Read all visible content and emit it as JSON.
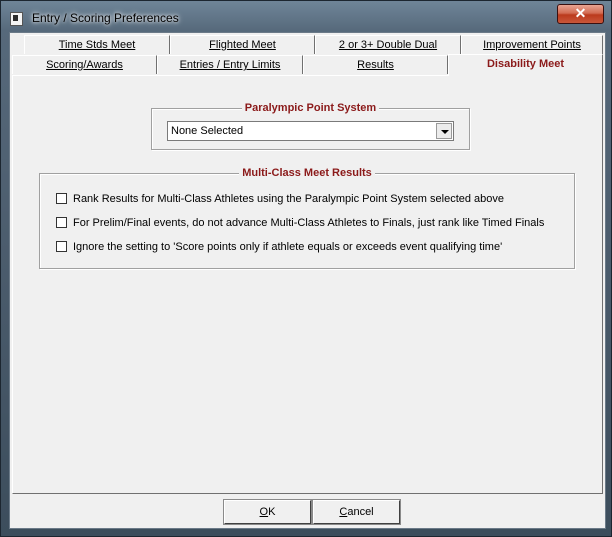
{
  "window": {
    "title": "Entry / Scoring Preferences",
    "close_label": "✕"
  },
  "tabs": {
    "row_top": [
      {
        "label": "Time Stds Meet"
      },
      {
        "label": "Flighted Meet"
      },
      {
        "label": "2 or 3+ Double Dual"
      },
      {
        "label": "Improvement Points"
      }
    ],
    "row_bottom": [
      {
        "label": "Scoring/Awards"
      },
      {
        "label": "Entries / Entry Limits"
      },
      {
        "label": "Results"
      },
      {
        "label": "Disability Meet",
        "active": true
      }
    ]
  },
  "paralympic": {
    "title": "Paralympic Point System",
    "selected": "None Selected"
  },
  "multiclass": {
    "title": "Multi-Class Meet Results",
    "options": [
      {
        "label": "Rank Results for Multi-Class Athletes using the Paralympic Point System selected above",
        "checked": false
      },
      {
        "label": "For Prelim/Final events, do not advance Multi-Class Athletes to Finals, just rank like Timed Finals",
        "checked": false
      },
      {
        "label": "Ignore the setting to 'Score points only if athlete equals or exceeds event qualifying time'",
        "checked": false
      }
    ]
  },
  "buttons": {
    "ok": {
      "underlined": "O",
      "rest": "K"
    },
    "cancel": {
      "underlined": "C",
      "rest": "ancel"
    }
  },
  "colors": {
    "accent_text": "#8b1a1a",
    "close_button": "#c9573a",
    "dialog_face": "#f0f0f0"
  },
  "icons": {
    "window_icon": "app-icon",
    "dropdown": "chevron-down-icon",
    "close": "close-icon"
  }
}
